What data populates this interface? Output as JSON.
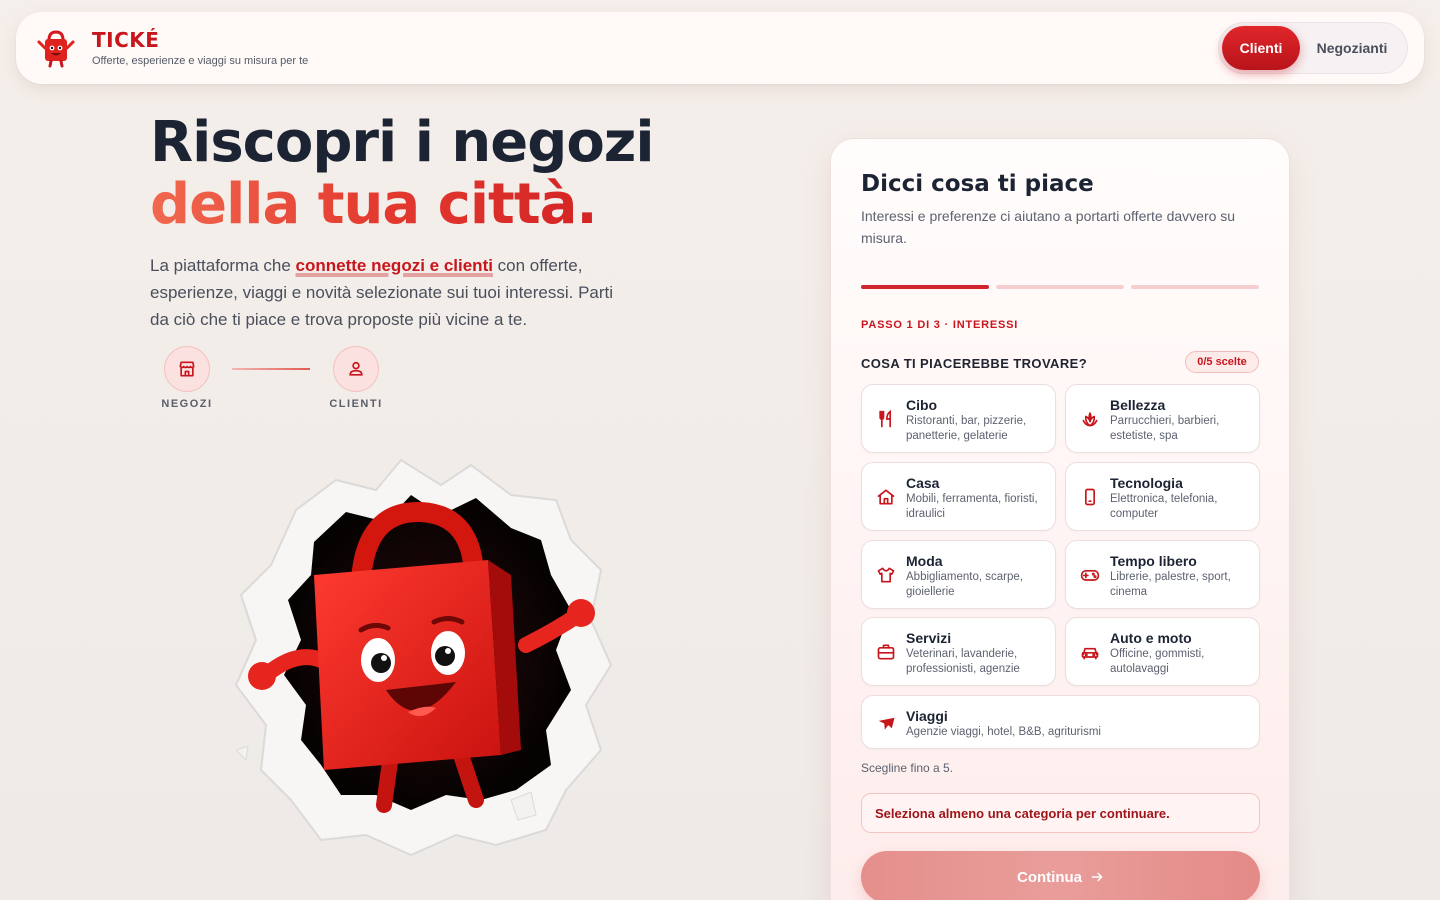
{
  "header": {
    "brand_name": "TICKÉ",
    "tagline": "Offerte, esperienze e viaggi su misura per te",
    "logo_icon": "shopping-bag-mascot-icon",
    "toggle": {
      "active": "Clienti",
      "inactive": "Negozianti"
    }
  },
  "hero": {
    "title_line1": "Riscopri i negozi",
    "title_line2": "della tua città.",
    "sub_before": "La piattaforma che ",
    "sub_highlight": "connette negozi e clienti",
    "sub_after": " con offerte, esperienze, viaggi e novità selezionate sui tuoi interessi. Parti da ciò che ti piace e trova proposte più vicine a te.",
    "flow": {
      "from_label": "NEGOZI",
      "from_icon": "store-icon",
      "to_label": "CLIENTI",
      "to_icon": "user-icon"
    }
  },
  "card": {
    "title": "Dicci cosa ti piace",
    "subtitle": "Interessi e preferenze ci aiutano a portarti offerte davvero su misura.",
    "progress": {
      "current": 1,
      "total": 3
    },
    "step_label": "PASSO 1 DI 3 · INTERESSI",
    "question": "COSA TI PIACEREBBE TROVARE?",
    "selection_count": "0/5 scelte",
    "categories": [
      {
        "name": "Cibo",
        "desc": "Ristoranti, bar, pizzerie, panetterie, gelaterie",
        "icon": "utensils-icon"
      },
      {
        "name": "Bellezza",
        "desc": "Parrucchieri, barbieri, estetiste, spa",
        "icon": "lotus-icon"
      },
      {
        "name": "Casa",
        "desc": "Mobili, ferramenta, fioristi, idraulici",
        "icon": "home-icon"
      },
      {
        "name": "Tecnologia",
        "desc": "Elettronica, telefonia, computer",
        "icon": "smartphone-icon"
      },
      {
        "name": "Moda",
        "desc": "Abbigliamento, scarpe, gioiellerie",
        "icon": "shirt-icon"
      },
      {
        "name": "Tempo libero",
        "desc": "Librerie, palestre, sport, cinema",
        "icon": "gamepad-icon"
      },
      {
        "name": "Servizi",
        "desc": "Veterinari, lavanderie, professionisti, agenzie",
        "icon": "briefcase-icon"
      },
      {
        "name": "Auto e moto",
        "desc": "Officine, gommisti, autolavaggi",
        "icon": "car-icon"
      },
      {
        "name": "Viaggi",
        "desc": "Agenzie viaggi, hotel, B&B, agriturismi",
        "icon": "plane-icon"
      }
    ],
    "hint": "Scegline fino a 5.",
    "alert": "Seleziona almeno una categoria per continuare.",
    "cta_label": "Continua"
  },
  "colors": {
    "brand": "#c8161d",
    "accent_light": "#fbe1df",
    "text_dark": "#1c2333"
  }
}
